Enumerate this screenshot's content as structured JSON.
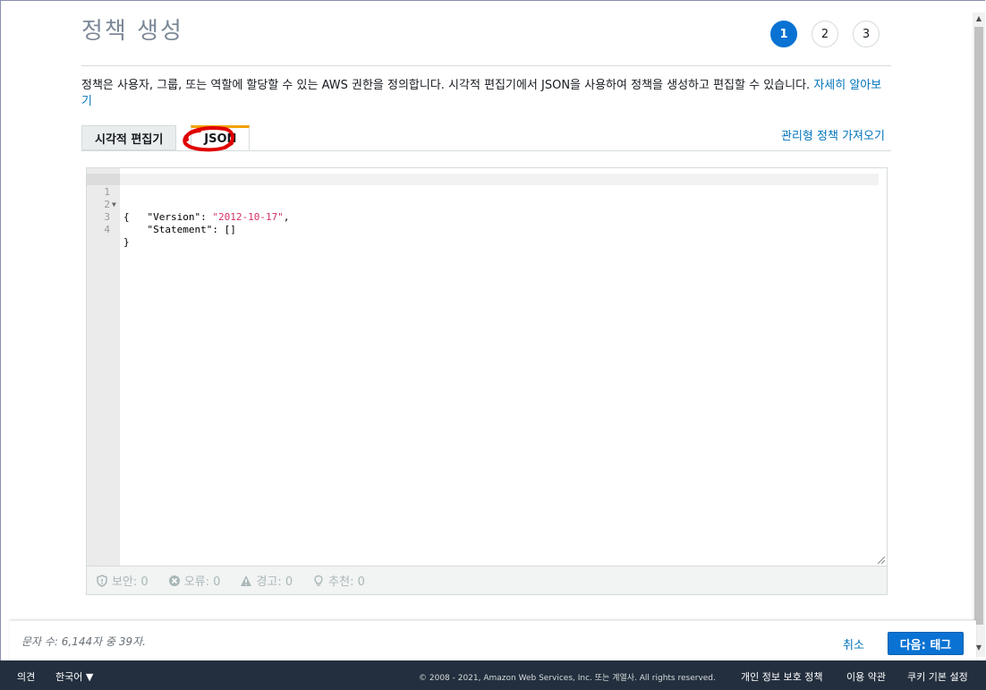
{
  "page": {
    "title": "정책 생성",
    "steps": [
      "1",
      "2",
      "3"
    ],
    "active_step": "1",
    "description": "정책은 사용자, 그룹, 또는 역할에 할당할 수 있는 AWS 권한을 정의합니다. 시각적 편집기에서 JSON을 사용하여 정책을 생성하고 편집할 수 있습니다.",
    "learn_more": "자세히 알아보기"
  },
  "tabs": [
    {
      "label": "시각적 편집기",
      "active": false
    },
    {
      "label": "JSON",
      "active": true
    }
  ],
  "import_link": "관리형 정책 가져오기",
  "editor": {
    "lines": [
      {
        "num": "1",
        "text": "{"
      },
      {
        "num": "2",
        "key": "    \"Version\": ",
        "value": "\"2012-10-17\"",
        "tail": ","
      },
      {
        "num": "3",
        "text": "    \"Statement\": []"
      },
      {
        "num": "4",
        "text": "}"
      }
    ]
  },
  "status": [
    {
      "icon": "shield-icon",
      "label": "보안: 0"
    },
    {
      "icon": "error-icon",
      "label": "오류: 0"
    },
    {
      "icon": "warning-icon",
      "label": "경고: 0"
    },
    {
      "icon": "lightbulb-icon",
      "label": "추천: 0"
    }
  ],
  "bottom": {
    "char_count": "문자 수: 6,144자 중 39자.",
    "cancel": "취소",
    "next": "다음: 태그"
  },
  "footer": {
    "feedback": "의견",
    "language": "한국어 ▼",
    "copyright": "© 2008 - 2021, Amazon Web Services, Inc. 또는 계열사. All rights reserved.",
    "privacy": "개인 정보 보호 정책",
    "terms": "이용 약관",
    "cookies": "쿠키 기본 설정"
  },
  "colors": {
    "primary": "#0972d3",
    "link": "#0073bb",
    "footer_bg": "#232f3e",
    "annotation": "#e00000"
  }
}
